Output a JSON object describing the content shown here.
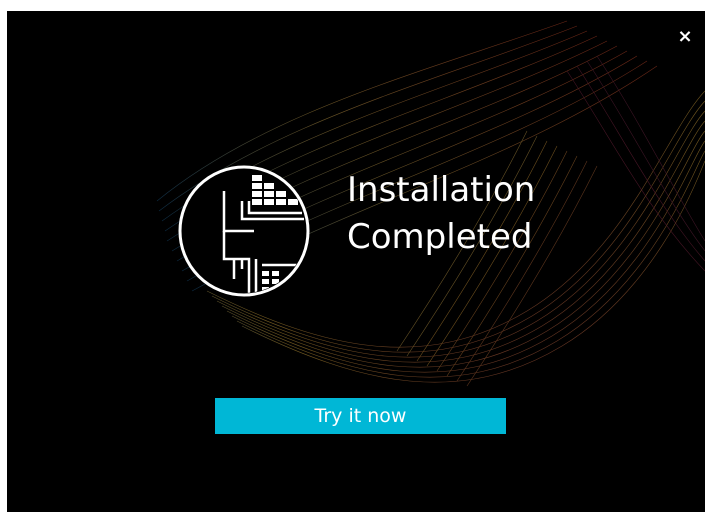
{
  "dialog": {
    "title_line1": "Installation",
    "title_line2": "Completed",
    "button_label": "Try it now",
    "close_glyph": "×"
  },
  "icons": {
    "close": "close-icon",
    "logo": "circuit-board-logo-icon"
  },
  "colors": {
    "background": "#000000",
    "button": "#00b7d6",
    "text": "#ffffff"
  }
}
